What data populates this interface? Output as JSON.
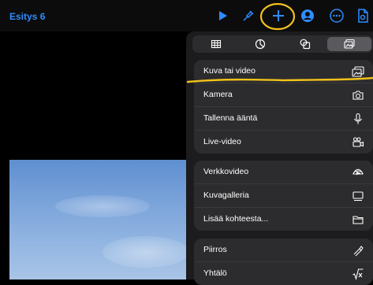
{
  "document": {
    "title": "Esitys 6"
  },
  "toolbar": {
    "play_icon": "play-icon",
    "format_icon": "paintbrush-icon",
    "insert_icon": "plus-icon",
    "collaborate_icon": "collaborate-icon",
    "more_icon": "ellipsis-icon",
    "document_icon": "document-icon"
  },
  "insert_panel": {
    "tabs": [
      {
        "icon": "table-icon",
        "active": false
      },
      {
        "icon": "chart-icon",
        "active": false
      },
      {
        "icon": "shapes-icon",
        "active": false
      },
      {
        "icon": "media-icon",
        "active": true
      }
    ],
    "groups": [
      {
        "items": [
          {
            "label": "Kuva tai video",
            "icon": "photo-icon"
          },
          {
            "label": "Kamera",
            "icon": "camera-icon"
          },
          {
            "label": "Tallenna ääntä",
            "icon": "microphone-icon"
          },
          {
            "label": "Live-video",
            "icon": "live-video-icon"
          }
        ]
      },
      {
        "items": [
          {
            "label": "Verkkovideo",
            "icon": "web-video-icon"
          },
          {
            "label": "Kuvagalleria",
            "icon": "gallery-icon"
          },
          {
            "label": "Lisää kohteesta...",
            "icon": "folder-icon"
          }
        ]
      },
      {
        "items": [
          {
            "label": "Piirros",
            "icon": "drawing-icon"
          },
          {
            "label": "Yhtälö",
            "icon": "equation-icon"
          }
        ]
      }
    ]
  },
  "colors": {
    "accent": "#2f8cff",
    "annotation": "#f3c21a"
  }
}
